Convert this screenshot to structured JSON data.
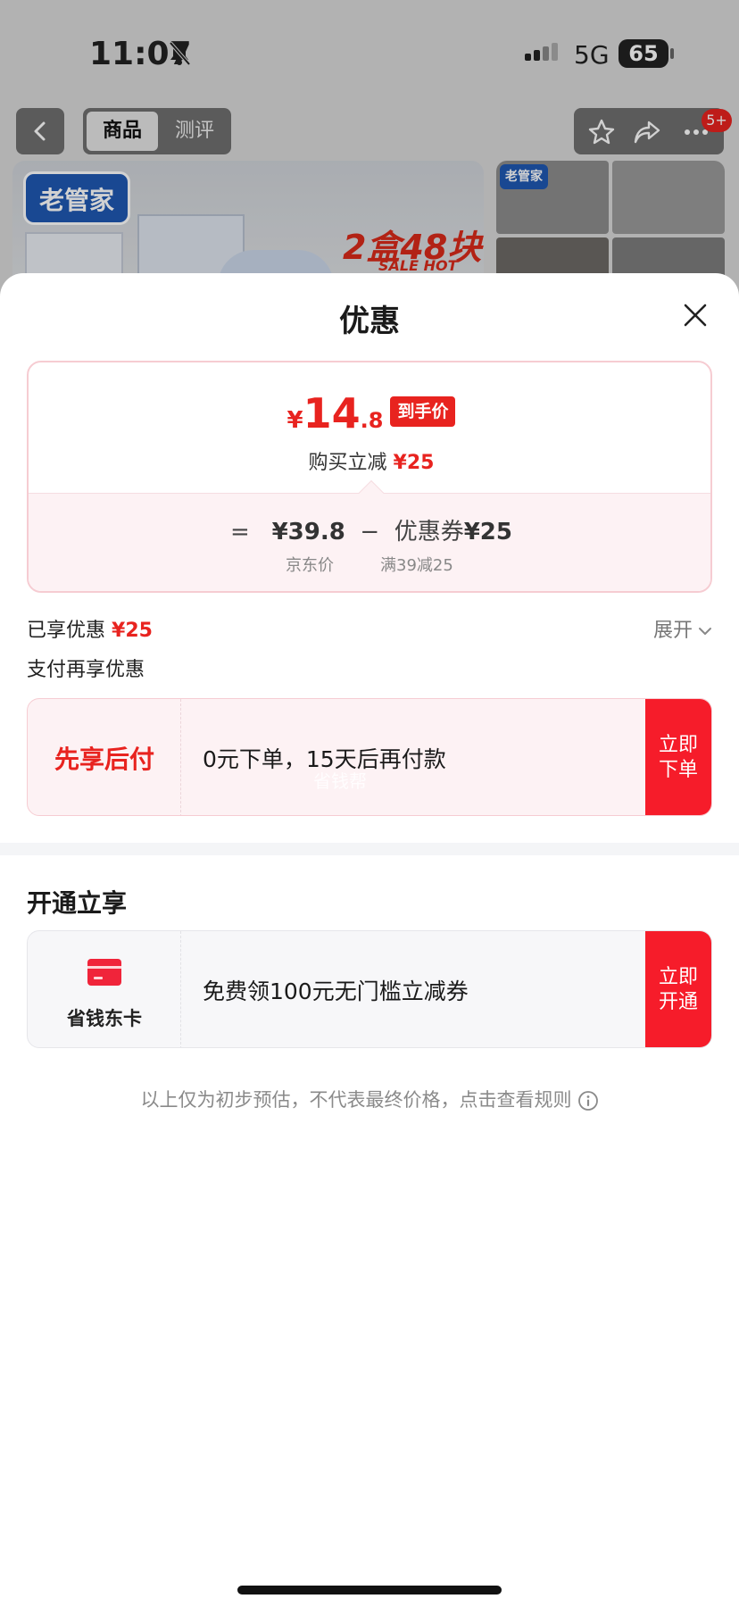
{
  "status_bar": {
    "time": "11:07",
    "network": "5G",
    "battery": "65"
  },
  "nav": {
    "tabs": [
      {
        "label": "商品"
      },
      {
        "label": "测评"
      }
    ],
    "badge": "5+"
  },
  "banner": {
    "logo": "老管家",
    "promo": "2盒48块",
    "sale": "SALE HOT"
  },
  "sheet": {
    "title": "优惠",
    "price": {
      "currency": "¥",
      "integer": "14",
      "decimal": ".8",
      "tag": "到手价",
      "subtitle_prefix": "购买立减",
      "subtitle_amount": "¥25"
    },
    "calc": {
      "equals": "=",
      "base_price": "¥39.8",
      "minus": "−",
      "coupon_label": "优惠券",
      "coupon_amount": "¥25",
      "base_caption": "京东价",
      "coupon_caption": "满39减25"
    },
    "enjoyed": {
      "label": "已享优惠",
      "amount": "¥25",
      "expand": "展开"
    },
    "pay_section_title": "支付再享优惠",
    "bnpl": {
      "brand": "先享后付",
      "text": "0元下单，15天后再付款",
      "watermark": "省钱帮",
      "button": "立即下单"
    },
    "open_section_title": "开通立享",
    "dongka": {
      "label": "省钱东卡",
      "text": "免费领100元无门槛立减券",
      "button": "立即开通"
    },
    "footnote": "以上仅为初步预估，不代表最终价格，点击查看规则"
  },
  "colors": {
    "accent": "#e8231f",
    "button": "#f61c2a",
    "card_pink": "#fdf2f4"
  }
}
